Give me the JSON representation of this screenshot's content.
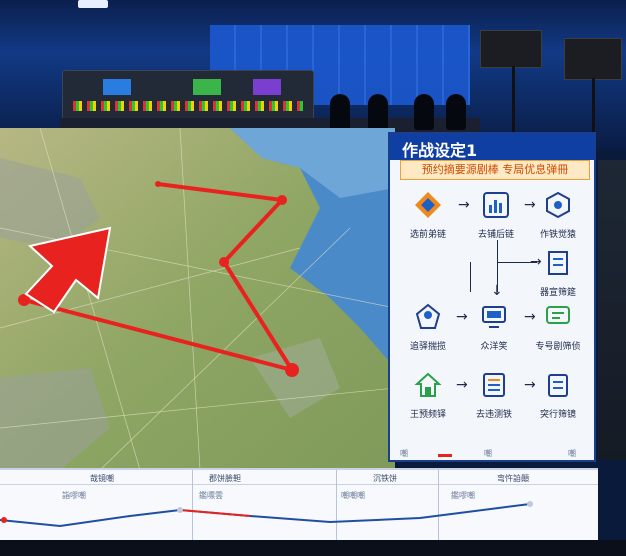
{
  "panel": {
    "title": "作战设定1",
    "subtitle": "预约摘要源剧棒   专局优息弹冊",
    "footer_tabs": [
      "嘲",
      "嘲",
      "嘲"
    ],
    "rows": [
      {
        "nodes": [
          {
            "label": "选前弟链",
            "icon": "diamond-logo-icon"
          },
          {
            "label": "去铺后链",
            "icon": "bar-chart-icon"
          },
          {
            "label": "作铁觉猿",
            "icon": "shield-icon"
          }
        ]
      },
      {
        "nodes": [
          {
            "label": "",
            "icon": "branch-arrow-icon"
          },
          {
            "label": "",
            "icon": "spacer"
          },
          {
            "label": "器宣筛筵",
            "icon": "document-stack-icon"
          }
        ]
      },
      {
        "nodes": [
          {
            "label": "追驿揣揽",
            "icon": "user-flag-icon"
          },
          {
            "label": "众洋笑",
            "icon": "monitor-icon"
          },
          {
            "label": "专号剧筛侦",
            "icon": "chat-bubble-icon"
          }
        ]
      },
      {
        "nodes": [
          {
            "label": "王预频铎",
            "icon": "home-icon"
          },
          {
            "label": "去违测铁",
            "icon": "list-icon"
          },
          {
            "label": "突行筛镜",
            "icon": "clipboard-icon"
          }
        ]
      }
    ]
  },
  "timeline": {
    "columns": [
      {
        "header": "哉镜嘲",
        "label": "詣嘐嘲"
      },
      {
        "header": "郡饼臉靼",
        "label": "鑑嘌雲"
      },
      {
        "header": "沉铁饼",
        "label": "嘲嘲嘲"
      },
      {
        "header": "弯忤詯顚",
        "label": "鑑嘐嘲"
      }
    ]
  },
  "colors": {
    "route": "#e8231f",
    "panel_header": "#0f3fa3",
    "accent_orange": "#f0a030",
    "timeline_line": "#1f4fa3"
  }
}
